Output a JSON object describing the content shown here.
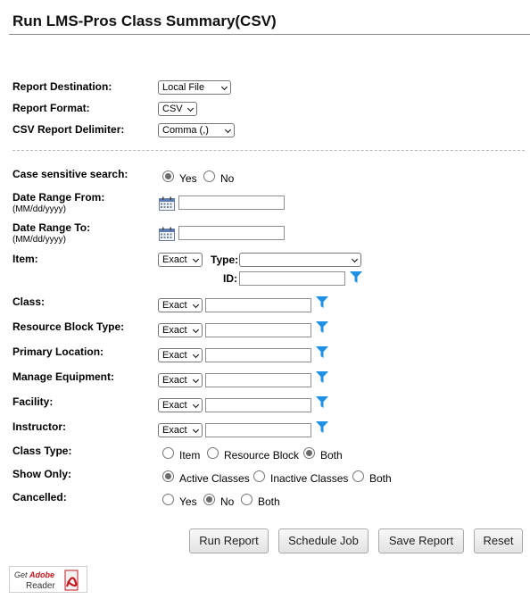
{
  "page_title": "Run LMS-Pros Class Summary(CSV)",
  "fields": {
    "report_destination": {
      "label": "Report Destination:",
      "value": "Local File"
    },
    "report_format": {
      "label": "Report Format:",
      "value": "CSV"
    },
    "csv_delimiter": {
      "label": "CSV Report Delimiter:",
      "value": "Comma (,)"
    },
    "case_sensitive": {
      "label": "Case sensitive search:",
      "options": [
        "Yes",
        "No"
      ],
      "selected": "Yes"
    },
    "date_from": {
      "label": "Date Range From:",
      "hint": "(MM/dd/yyyy)",
      "value": ""
    },
    "date_to": {
      "label": "Date Range To:",
      "hint": "(MM/dd/yyyy)",
      "value": ""
    },
    "item": {
      "label": "Item:",
      "match": "Exact",
      "type_label": "Type:",
      "type_value": "",
      "id_label": "ID:",
      "id_value": ""
    },
    "class": {
      "label": "Class:",
      "match": "Exact",
      "value": ""
    },
    "resource_block_type": {
      "label": "Resource Block Type:",
      "match": "Exact",
      "value": ""
    },
    "primary_location": {
      "label": "Primary Location:",
      "match": "Exact",
      "value": ""
    },
    "manage_equipment": {
      "label": "Manage Equipment:",
      "match": "Exact",
      "value": ""
    },
    "facility": {
      "label": "Facility:",
      "match": "Exact",
      "value": ""
    },
    "instructor": {
      "label": "Instructor:",
      "match": "Exact",
      "value": ""
    },
    "class_type": {
      "label": "Class Type:",
      "options": [
        "Item",
        "Resource Block",
        "Both"
      ],
      "selected": "Both"
    },
    "show_only": {
      "label": "Show Only:",
      "options": [
        "Active Classes",
        "Inactive Classes",
        "Both"
      ],
      "selected": "Active Classes"
    },
    "cancelled": {
      "label": "Cancelled:",
      "options": [
        "Yes",
        "No",
        "Both"
      ],
      "selected": "No"
    }
  },
  "buttons": {
    "run": "Run Report",
    "schedule": "Schedule Job",
    "save": "Save Report",
    "reset": "Reset"
  },
  "badge": {
    "line1_prefix": "Get",
    "line1_brand": "Adobe",
    "line2": "Reader"
  },
  "colors": {
    "filter_icon": "#1e90e6",
    "radio_selected": "#6b6b6b",
    "adobe_red": "#c4161c"
  }
}
